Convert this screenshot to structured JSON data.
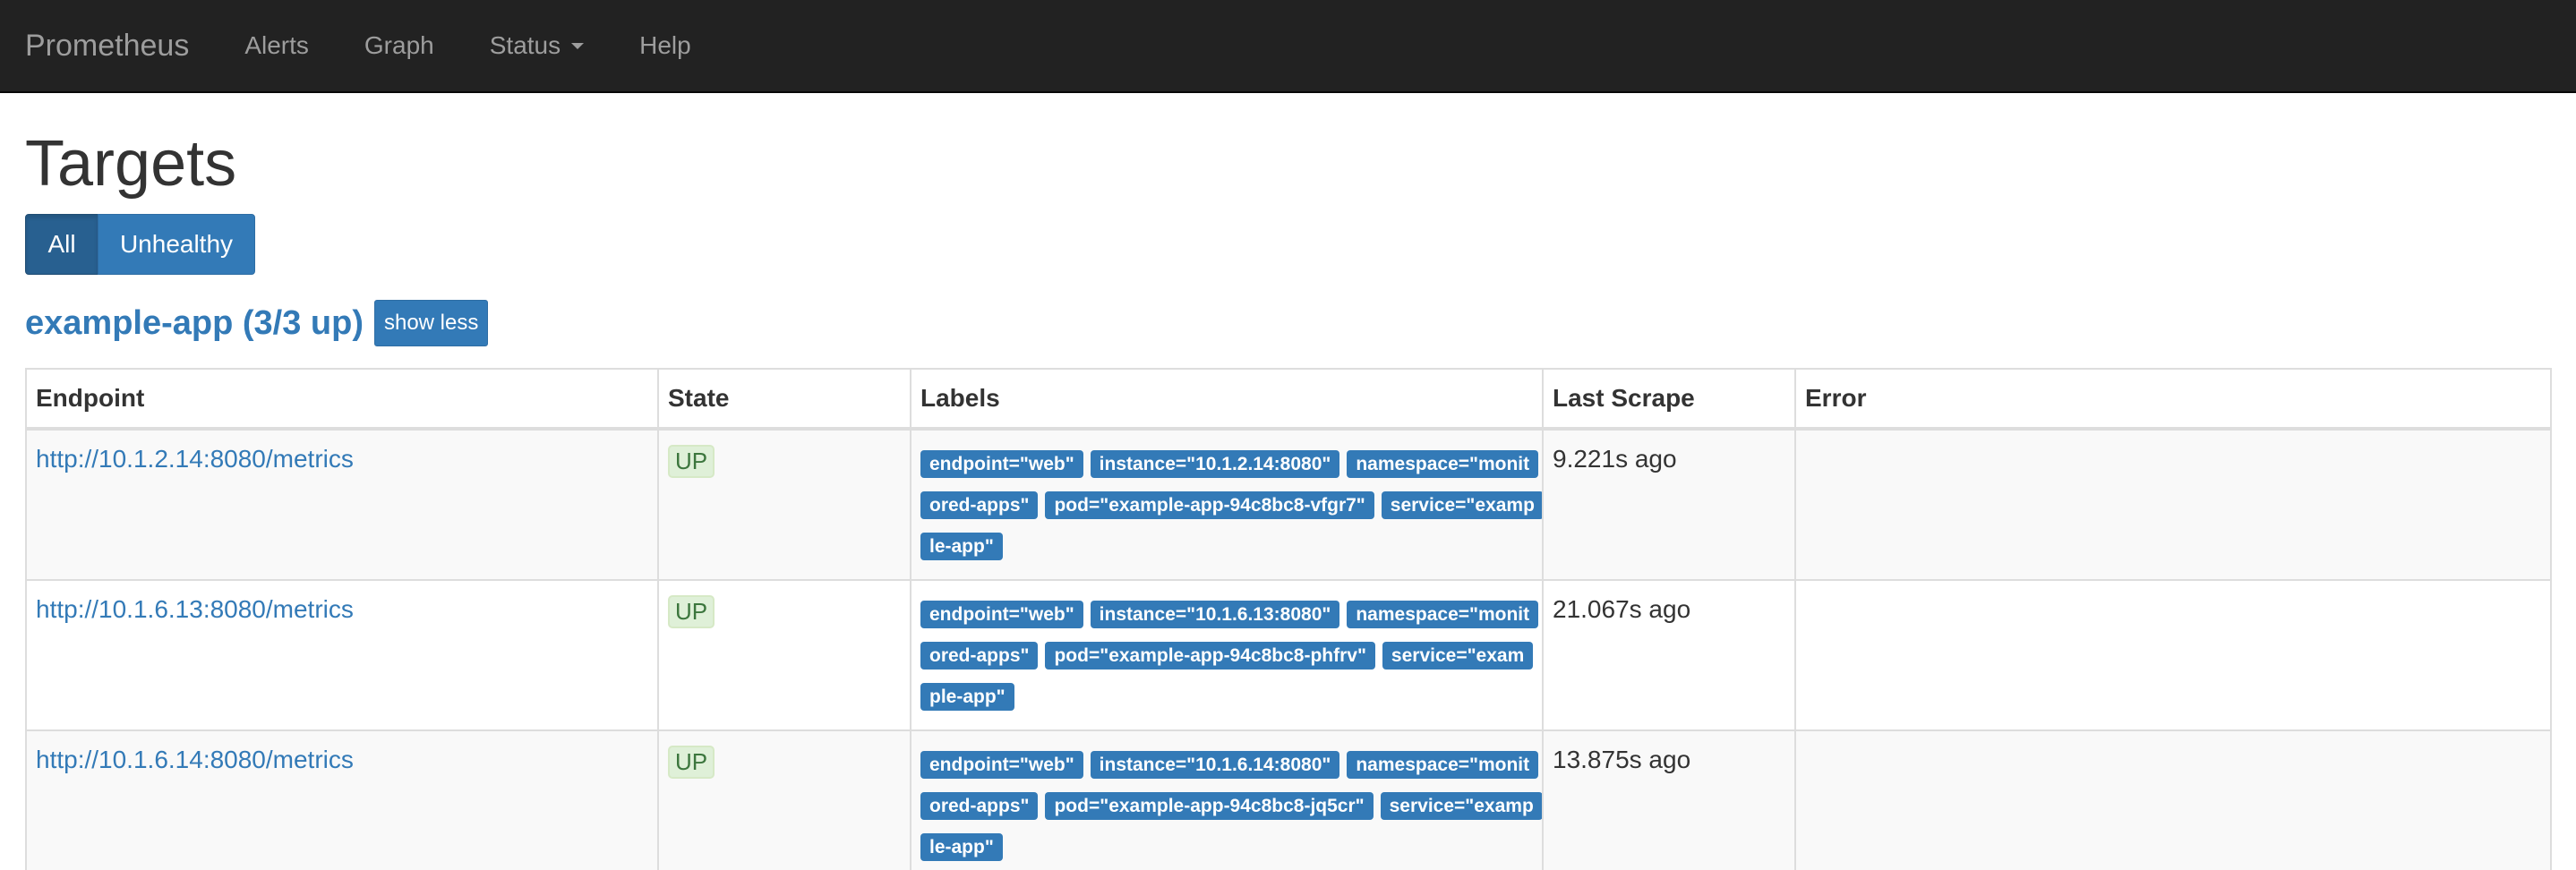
{
  "navbar": {
    "brand": "Prometheus",
    "links": [
      {
        "label": "Alerts"
      },
      {
        "label": "Graph"
      },
      {
        "label": "Status"
      },
      {
        "label": "Help"
      }
    ]
  },
  "page": {
    "title": "Targets",
    "filters": {
      "all": "All",
      "unhealthy": "Unhealthy"
    }
  },
  "job": {
    "title": "example-app (3/3 up)",
    "toggle_label": "show less"
  },
  "table": {
    "headers": [
      "Endpoint",
      "State",
      "Labels",
      "Last Scrape",
      "Error"
    ],
    "rows": [
      {
        "endpoint": "http://10.1.2.14:8080/metrics",
        "state": "UP",
        "labels": [
          "endpoint=\"web\"",
          "instance=\"10.1.2.14:8080\"",
          "namespace=\"monitored-apps\"",
          "pod=\"example-app-94c8bc8-vfgr7\"",
          "service=\"example-app\""
        ],
        "last_scrape": "9.221s ago",
        "error": ""
      },
      {
        "endpoint": "http://10.1.6.13:8080/metrics",
        "state": "UP",
        "labels": [
          "endpoint=\"web\"",
          "instance=\"10.1.6.13:8080\"",
          "namespace=\"monitored-apps\"",
          "pod=\"example-app-94c8bc8-phfrv\"",
          "service=\"example-app\""
        ],
        "last_scrape": "21.067s ago",
        "error": ""
      },
      {
        "endpoint": "http://10.1.6.14:8080/metrics",
        "state": "UP",
        "labels": [
          "endpoint=\"web\"",
          "instance=\"10.1.6.14:8080\"",
          "namespace=\"monitored-apps\"",
          "pod=\"example-app-94c8bc8-jq5cr\"",
          "service=\"example-app\""
        ],
        "last_scrape": "13.875s ago",
        "error": ""
      }
    ]
  },
  "colors": {
    "navbar_bg": "#222222",
    "primary": "#337ab7",
    "up_badge_bg": "#dff0d8",
    "up_badge_text": "#3c763d"
  }
}
